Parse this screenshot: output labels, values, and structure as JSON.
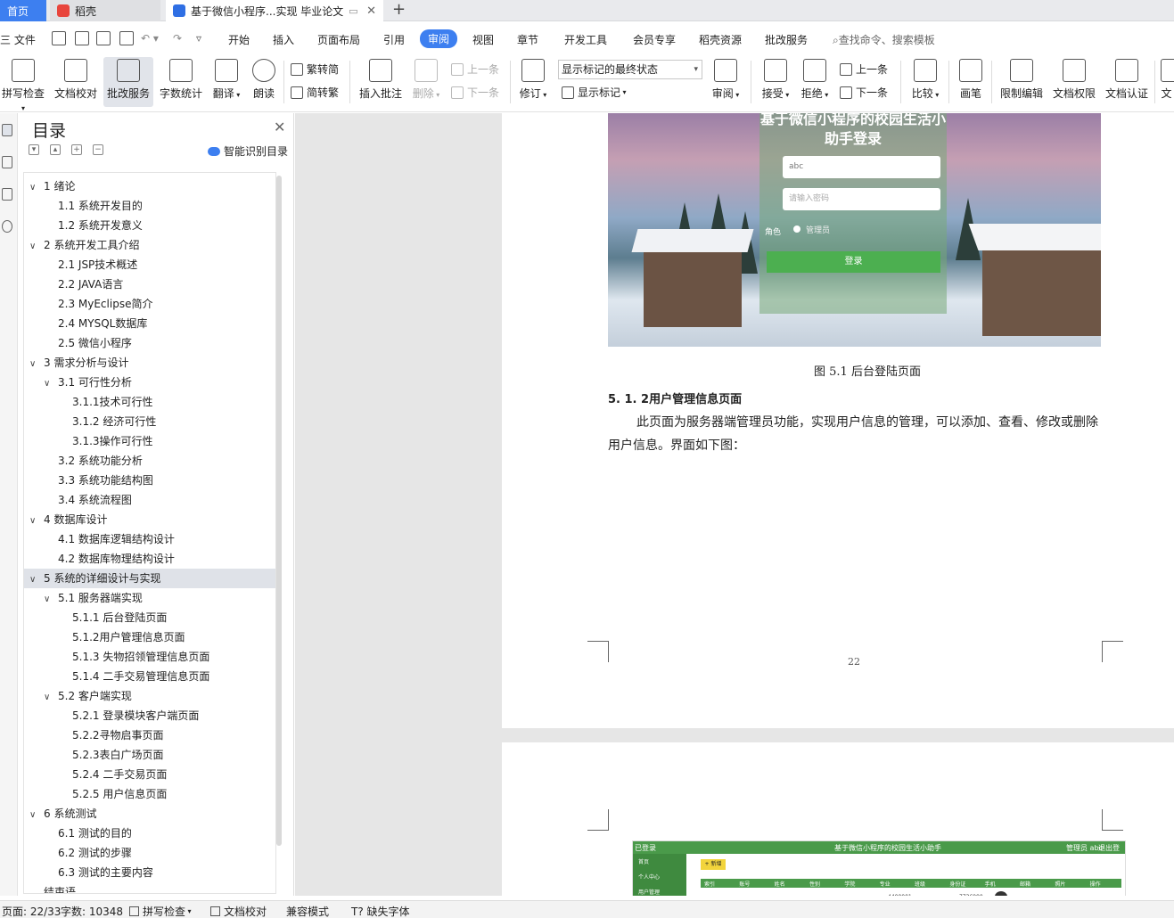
{
  "tabs": {
    "home": "首页",
    "daoke": "稻壳",
    "document": "基于微信小程序...实现 毕业论文",
    "add": "+"
  },
  "menu": {
    "file": "三 文件",
    "items": [
      "开始",
      "插入",
      "页面布局",
      "引用",
      "审阅",
      "视图",
      "章节",
      "开发工具",
      "会员专享",
      "稻壳资源",
      "批改服务"
    ],
    "active": "审阅",
    "search": "查找命令、搜索模板"
  },
  "ribbon": {
    "spellcheck": "拼写检查",
    "doc_check": "文档校对",
    "review_service": "批改服务",
    "word_count": "字数统计",
    "translate": "翻译",
    "read_aloud": "朗读",
    "trad_to_simp": "繁转简",
    "simp_to_trad": "简转繁",
    "insert_comment": "插入批注",
    "delete": "删除",
    "prev_comment": "上一条",
    "next_comment": "下一条",
    "track_changes": "修订",
    "markup_mode": "显示标记的最终状态",
    "show_markup": "显示标记",
    "review": "审阅",
    "accept": "接受",
    "reject": "拒绝",
    "prev_change": "上一条",
    "next_change": "下一条",
    "compare": "比较",
    "ink": "画笔",
    "restrict_edit": "限制编辑",
    "doc_permission": "文档权限",
    "doc_cert": "文档认证",
    "more": "文"
  },
  "toc": {
    "title": "目录",
    "smart": "智能识别目录",
    "items": [
      {
        "level": 1,
        "text": "1  绪论",
        "expanded": true
      },
      {
        "level": 2,
        "text": "1.1  系统开发目的"
      },
      {
        "level": 2,
        "text": "1.2  系统开发意义"
      },
      {
        "level": 1,
        "text": "2  系统开发工具介绍",
        "expanded": true
      },
      {
        "level": 2,
        "text": "2.1 JSP技术概述"
      },
      {
        "level": 2,
        "text": "2.2 JAVA语言"
      },
      {
        "level": 2,
        "text": "2.3 MyEclipse简介"
      },
      {
        "level": 2,
        "text": "2.4 MYSQL数据库"
      },
      {
        "level": 2,
        "text": "2.5  微信小程序"
      },
      {
        "level": 1,
        "text": "3  需求分析与设计",
        "expanded": true
      },
      {
        "level": 2,
        "text": "3.1  可行性分析",
        "expanded": true
      },
      {
        "level": 3,
        "text": "3.1.1技术可行性"
      },
      {
        "level": 3,
        "text": "3.1.2  经济可行性"
      },
      {
        "level": 3,
        "text": "3.1.3操作可行性"
      },
      {
        "level": 2,
        "text": "3.2  系统功能分析"
      },
      {
        "level": 2,
        "text": "3.3  系统功能结构图"
      },
      {
        "level": 2,
        "text": "3.4  系统流程图"
      },
      {
        "level": 1,
        "text": "4  数据库设计",
        "expanded": true
      },
      {
        "level": 2,
        "text": "4.1  数据库逻辑结构设计"
      },
      {
        "level": 2,
        "text": "4.2  数据库物理结构设计"
      },
      {
        "level": 1,
        "text": "5  系统的详细设计与实现",
        "expanded": true,
        "selected": true
      },
      {
        "level": 2,
        "text": "5.1  服务器端实现",
        "expanded": true
      },
      {
        "level": 3,
        "text": "5.1.1  后台登陆页面"
      },
      {
        "level": 3,
        "text": "5.1.2用户管理信息页面"
      },
      {
        "level": 3,
        "text": "5.1.3  失物招领管理信息页面"
      },
      {
        "level": 3,
        "text": "5.1.4  二手交易管理信息页面"
      },
      {
        "level": 2,
        "text": "5.2  客户端实现",
        "expanded": true
      },
      {
        "level": 3,
        "text": "5.2.1  登录模块客户端页面"
      },
      {
        "level": 3,
        "text": "5.2.2寻物启事页面"
      },
      {
        "level": 3,
        "text": "5.2.3表白广场页面"
      },
      {
        "level": 3,
        "text": "5.2.4  二手交易页面"
      },
      {
        "level": 3,
        "text": "5.2.5  用户信息页面"
      },
      {
        "level": 1,
        "text": "6  系统测试",
        "expanded": true
      },
      {
        "level": 2,
        "text": "6.1  测试的目的"
      },
      {
        "level": 2,
        "text": "6.2  测试的步骤"
      },
      {
        "level": 2,
        "text": "6.3  测试的主要内容"
      },
      {
        "level": 1,
        "text": "结束语"
      }
    ]
  },
  "document": {
    "login_title": "基于微信小程序的校园生活小助手登录",
    "login_user_value": "abc",
    "login_password_placeholder": "请输入密码",
    "login_role_label": "角色",
    "login_role_option": "管理员",
    "login_button": "登录",
    "figure_caption": "图 5.1 后台登陆页面",
    "section_heading": "5. 1. 2用户管理信息页面",
    "paragraph": "此页面为服务器端管理员功能，实现用户信息的管理，可以添加、查看、修改或删除用户信息。界面如下图：",
    "page_number": "22",
    "admin_shot": {
      "brand": "已登录",
      "title": "基于微信小程序的校园生活小助手",
      "user": "管理员 abc",
      "logout": "退出登录",
      "side_items": [
        "首页",
        "个人中心",
        "用户管理"
      ],
      "add_button": "+ 新增",
      "columns": [
        "索引",
        "账号",
        "姓名",
        "性别",
        "学院",
        "专业",
        "班级",
        "身份证",
        "手机",
        "邮箱",
        "照片",
        "操作"
      ],
      "row_values": [
        "4400001",
        "7736990"
      ]
    }
  },
  "status": {
    "page": "页面: 22/33",
    "words": "字数: 10348",
    "spellcheck": "拼写检查",
    "doc_check": "文档校对",
    "compat": "兼容模式",
    "missing_font": "缺失字体"
  }
}
